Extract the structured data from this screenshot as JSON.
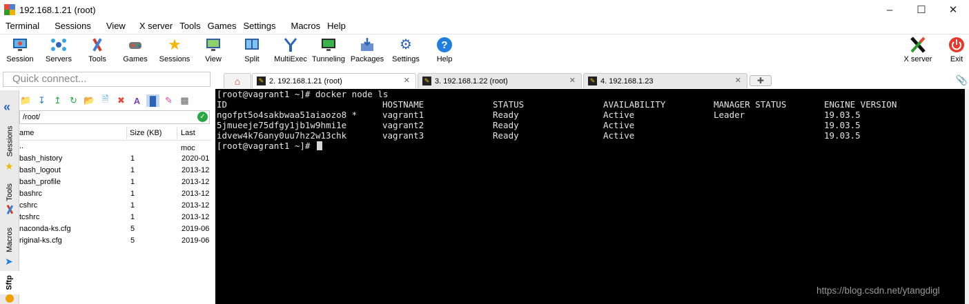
{
  "window": {
    "title": "192.168.1.21 (root)"
  },
  "menu": [
    "Terminal",
    "Sessions",
    "View",
    "X server",
    "Tools",
    "Games",
    "Settings",
    "Macros",
    "Help"
  ],
  "toolbar": {
    "session": "Session",
    "servers": "Servers",
    "tools": "Tools",
    "games": "Games",
    "sessions": "Sessions",
    "view": "View",
    "split": "Split",
    "multiexec": "MultiExec",
    "tunneling": "Tunneling",
    "packages": "Packages",
    "settings": "Settings",
    "help": "Help",
    "xserver": "X server",
    "exit": "Exit"
  },
  "quick_connect": {
    "placeholder": "Quick connect..."
  },
  "side_tabs": {
    "sessions": "Sessions",
    "tools": "Tools",
    "macros": "Macros",
    "sftp": "Sftp"
  },
  "sftp": {
    "path": "/root/",
    "columns": {
      "name": "ame",
      "size": "Size (KB)",
      "modified": "Last moc"
    },
    "files": [
      {
        "name": "..",
        "size": "",
        "modified": ""
      },
      {
        "name": "bash_history",
        "size": "1",
        "modified": "2020-01"
      },
      {
        "name": "bash_logout",
        "size": "1",
        "modified": "2013-12"
      },
      {
        "name": "bash_profile",
        "size": "1",
        "modified": "2013-12"
      },
      {
        "name": "bashrc",
        "size": "1",
        "modified": "2013-12"
      },
      {
        "name": "cshrc",
        "size": "1",
        "modified": "2013-12"
      },
      {
        "name": "tcshrc",
        "size": "1",
        "modified": "2013-12"
      },
      {
        "name": "naconda-ks.cfg",
        "size": "5",
        "modified": "2019-06"
      },
      {
        "name": "riginal-ks.cfg",
        "size": "5",
        "modified": "2019-06"
      }
    ]
  },
  "tabs": [
    {
      "label": "2. 192.168.1.21 (root)",
      "active": true
    },
    {
      "label": "3. 192.168.1.22 (root)",
      "active": false
    },
    {
      "label": "4. 192.168.1.23",
      "active": false
    }
  ],
  "terminal": {
    "prompt_command": "[root@vagrant1 ~]# docker node ls",
    "headers": [
      "ID",
      "HOSTNAME",
      "STATUS",
      "AVAILABILITY",
      "MANAGER STATUS",
      "ENGINE VERSION"
    ],
    "rows": [
      [
        "ngofpt5o4sakbwaa51aiaozo8 *",
        "vagrant1",
        "Ready",
        "Active",
        "Leader",
        "19.03.5"
      ],
      [
        "5jmueeje75dfgy1jb1w9hmi1e",
        "vagrant2",
        "Ready",
        "Active",
        "",
        "19.03.5"
      ],
      [
        "idvew4k76any0uu7hz2w13chk",
        "vagrant3",
        "Ready",
        "Active",
        "",
        "19.03.5"
      ]
    ],
    "final_prompt": "[root@vagrant1 ~]#"
  },
  "watermark": "https://blog.csdn.net/ytangdigl"
}
